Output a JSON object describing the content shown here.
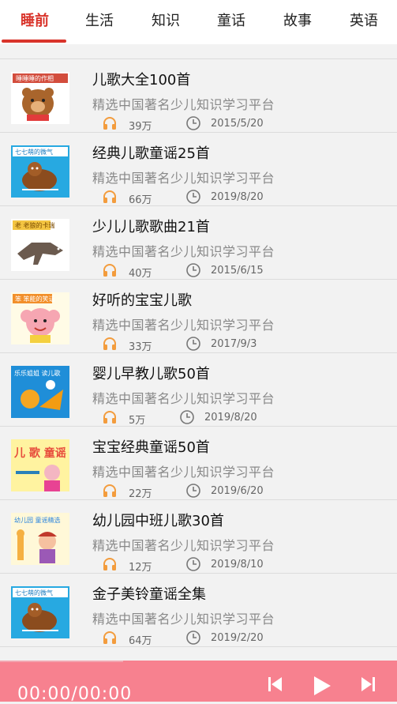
{
  "tabs": [
    {
      "label": "睡前",
      "active": true
    },
    {
      "label": "生活",
      "active": false
    },
    {
      "label": "知识",
      "active": false
    },
    {
      "label": "童话",
      "active": false
    },
    {
      "label": "故事",
      "active": false
    },
    {
      "label": "英语",
      "active": false
    }
  ],
  "items": [
    {
      "title": "儿歌大全100首",
      "subtitle": "精选中国著名少儿知识学习平台",
      "plays": "39万",
      "date": "2015/5/20",
      "thumb_text": "睡睡睡的作相",
      "thumb_color": "#ffffff"
    },
    {
      "title": "经典儿歌童谣25首",
      "subtitle": "精选中国著名少儿知识学习平台",
      "plays": "66万",
      "date": "2019/8/20",
      "thumb_text": "七七萌的微气",
      "thumb_color": "#27a9e1"
    },
    {
      "title": "少儿儿歌歌曲21首",
      "subtitle": "精选中国著名少儿知识学习平台",
      "plays": "40万",
      "date": "2015/6/15",
      "thumb_text": "老 老狼的卡瑞",
      "thumb_color": "#ffffff"
    },
    {
      "title": "好听的宝宝儿歌",
      "subtitle": "精选中国著名少儿知识学习平台",
      "plays": "33万",
      "date": "2017/9/3",
      "thumb_text": "笨 笨能的笑话",
      "thumb_color": "#fffbe6"
    },
    {
      "title": "婴儿早教儿歌50首",
      "subtitle": "精选中国著名少儿知识学习平台",
      "plays": "5万",
      "date": "2019/8/20",
      "thumb_text": "乐乐姐姐 读儿歌",
      "thumb_color": "#1f8ed8"
    },
    {
      "title": "宝宝经典童谣50首",
      "subtitle": "精选中国著名少儿知识学习平台",
      "plays": "22万",
      "date": "2019/6/20",
      "thumb_text": "儿 歌 童谣",
      "thumb_color": "#fff3a0"
    },
    {
      "title": "幼儿园中班儿歌30首",
      "subtitle": "精选中国著名少儿知识学习平台",
      "plays": "12万",
      "date": "2019/8/10",
      "thumb_text": "幼儿园 童谣精选",
      "thumb_color": "#fff8d8"
    },
    {
      "title": "金子美铃童谣全集",
      "subtitle": "精选中国著名少儿知识学习平台",
      "plays": "64万",
      "date": "2019/2/20",
      "thumb_text": "七七萌的微气",
      "thumb_color": "#27a9e1"
    }
  ],
  "player": {
    "time": "00:00/00:00",
    "bar_color": "#f7818f"
  },
  "colors": {
    "accent": "#d9342b",
    "icon_orange": "#f39c3d"
  },
  "icons": {
    "play_count": "headphones-icon",
    "date": "clock-icon",
    "prev": "skip-previous-icon",
    "play": "play-icon",
    "next": "skip-next-icon"
  }
}
